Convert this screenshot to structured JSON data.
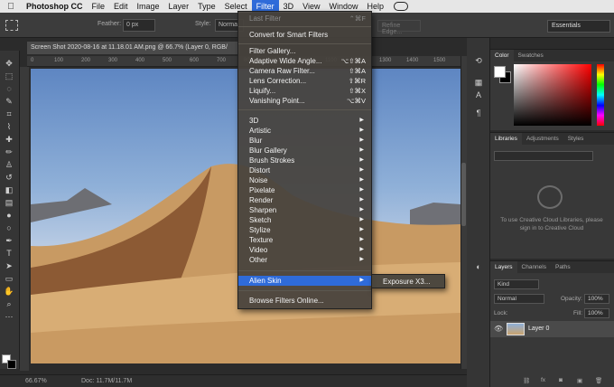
{
  "menubar": {
    "app": "Photoshop CC",
    "items": [
      "File",
      "Edit",
      "Image",
      "Layer",
      "Type",
      "Select",
      "Filter",
      "3D",
      "View",
      "Window",
      "Help"
    ],
    "active": "Filter"
  },
  "options": {
    "feather_label": "Feather:",
    "feather_value": "0 px",
    "style_label": "Style:",
    "style_value": "Normal",
    "refine_edge": "Refine Edge...",
    "workspace": "Essentials"
  },
  "document": {
    "tab_title": "Screen Shot 2020-08-16 at 11.18.01 AM.png @ 66.7% (Layer 0, RGB/",
    "ruler_ticks": [
      "0",
      "100",
      "200",
      "300",
      "400",
      "500",
      "600",
      "700",
      "800",
      "900",
      "1000",
      "1100",
      "1200",
      "1300",
      "1400",
      "1500"
    ],
    "zoom": "66.67%",
    "doc_info": "Doc: 11.7M/11.7M"
  },
  "filter_menu": {
    "last_filter": "Last Filter",
    "last_filter_shortcut": "⌃⌘F",
    "convert": "Convert for Smart Filters",
    "group1": [
      {
        "label": "Filter Gallery...",
        "shortcut": ""
      },
      {
        "label": "Adaptive Wide Angle...",
        "shortcut": "⌥⇧⌘A"
      },
      {
        "label": "Camera Raw Filter...",
        "shortcut": "⇧⌘A"
      },
      {
        "label": "Lens Correction...",
        "shortcut": "⇧⌘R"
      },
      {
        "label": "Liquify...",
        "shortcut": "⇧⌘X"
      },
      {
        "label": "Vanishing Point...",
        "shortcut": "⌥⌘V"
      }
    ],
    "submenus": [
      "3D",
      "Artistic",
      "Blur",
      "Blur Gallery",
      "Brush Strokes",
      "Distort",
      "Noise",
      "Pixelate",
      "Render",
      "Sharpen",
      "Sketch",
      "Stylize",
      "Texture",
      "Video",
      "Other"
    ],
    "alien_skin": "Alien Skin",
    "browse": "Browse Filters Online...",
    "alien_skin_submenu": [
      "Exposure X3..."
    ]
  },
  "panels": {
    "color_tabs": [
      "Color",
      "Swatches"
    ],
    "library_tabs": [
      "Libraries",
      "Adjustments",
      "Styles"
    ],
    "library_message": "To use Creative Cloud Libraries, please sign in to Creative Cloud",
    "layers_tabs": [
      "Layers",
      "Channels",
      "Paths"
    ],
    "kind": "Kind",
    "blend_mode": "Normal",
    "opacity_label": "Opacity:",
    "opacity_value": "100%",
    "lock_label": "Lock:",
    "fill_label": "Fill:",
    "fill_value": "100%",
    "layer_name": "Layer 0"
  },
  "icons": [
    "apple-icon",
    "creative-cloud-icon",
    "marquee-icon",
    "move-icon",
    "lasso-icon",
    "crop-icon",
    "brush-icon",
    "eraser-icon",
    "type-icon",
    "zoom-icon",
    "eye-icon",
    "fx-icon",
    "trash-icon"
  ]
}
